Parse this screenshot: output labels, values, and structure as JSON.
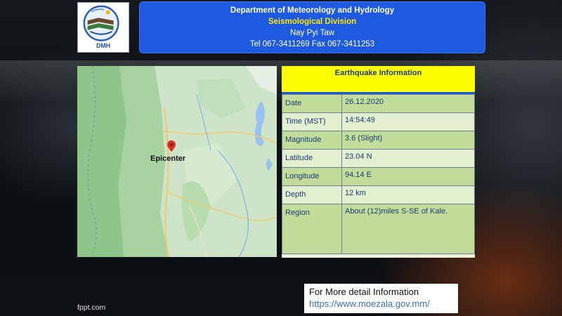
{
  "header": {
    "department": "Department of Meteorology and Hydrology",
    "division": "Seismological Division",
    "city": "Nay Pyi Taw",
    "contact": "Tel 067-3411269 Fax 067-3411253"
  },
  "logo": {
    "text": "DMH"
  },
  "map": {
    "epicenter_label": "Epicenter"
  },
  "info": {
    "title": "Earthquake  Information",
    "rows": [
      {
        "label": "Date",
        "value": "26.12.2020"
      },
      {
        "label": "Time (MST)",
        "value": "14:54:49"
      },
      {
        "label": "Magnitude",
        "value": "3.6 (Slight)"
      },
      {
        "label": "Latitude",
        "value": "23.04  N"
      },
      {
        "label": "Longitude",
        "value": "94.14  E"
      },
      {
        "label": "Depth",
        "value": "12 km"
      },
      {
        "label": "Region",
        "value": "About (12)miles S-SE of  Kale."
      }
    ]
  },
  "more_info": {
    "text": "For More detail Information",
    "url": "https://www.moezala.gov.mm/"
  },
  "footer": {
    "text": "fppt.com"
  },
  "colors": {
    "header_bg": "#1e5ae0",
    "division_text": "#ffe600",
    "info_title_bg": "#ffff00",
    "row_dark": "#c2dd9a",
    "row_light": "#e3f0cf",
    "marker": "#d93025"
  }
}
